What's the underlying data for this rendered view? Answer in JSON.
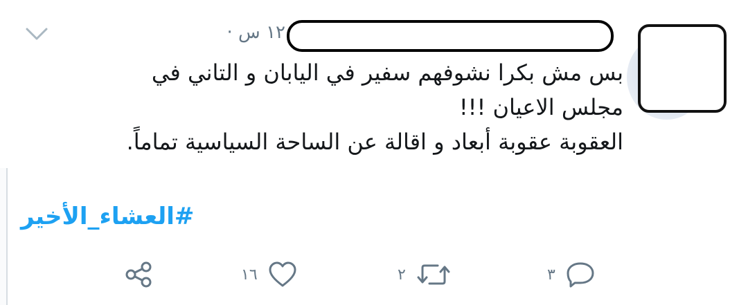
{
  "tweet": {
    "timestamp": "١٢ س ·",
    "text_lines": [
      "بس مش بكرا نشوفهم سفير في اليابان و التاني في",
      "مجلس الاعيان !!!",
      "العقوبة عقوبة أبعاد و اقالة عن الساحة السياسية تماماً."
    ],
    "hashtag": "#العشاء_الأخير"
  },
  "actions": {
    "reply_count": "٣",
    "retweet_count": "٢",
    "like_count": "١٦"
  },
  "icons": {
    "menu": "chevron-down-icon",
    "reply": "reply-icon",
    "retweet": "retweet-icon",
    "like": "heart-icon",
    "share": "share-icon"
  },
  "colors": {
    "hashtag": "#1da1f2",
    "muted": "#657786",
    "text": "#14171a"
  }
}
